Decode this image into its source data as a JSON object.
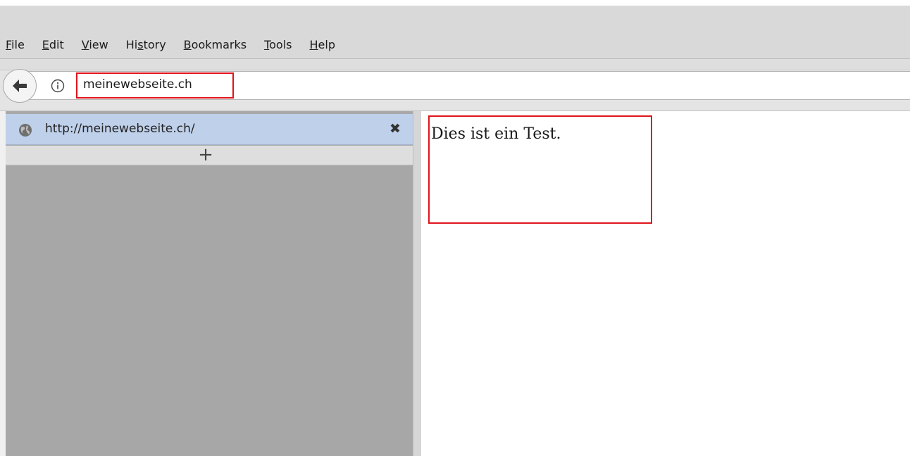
{
  "menubar": {
    "items": [
      {
        "label": "File",
        "underline": "F",
        "rest": "ile"
      },
      {
        "label": "Edit",
        "underline": "E",
        "rest": "dit"
      },
      {
        "label": "View",
        "underline": "V",
        "rest": "iew"
      },
      {
        "label": "History",
        "pre": "Hi",
        "underline": "s",
        "rest": "tory"
      },
      {
        "label": "Bookmarks",
        "underline": "B",
        "rest": "ookmarks"
      },
      {
        "label": "Tools",
        "underline": "T",
        "rest": "ools"
      },
      {
        "label": "Help",
        "underline": "H",
        "rest": "elp"
      }
    ]
  },
  "navbar": {
    "url": "meinewebseite.ch",
    "back_icon": "back-arrow-icon",
    "info_icon": "info-icon"
  },
  "sidebar": {
    "tabs": [
      {
        "title": "http://meinewebseite.ch/",
        "icon": "globe-icon",
        "close": "✖"
      }
    ],
    "new_tab": "+"
  },
  "page": {
    "text": "Dies ist ein Test."
  },
  "colors": {
    "highlight": "#e0141b",
    "selected_tab": "#bfd0ea",
    "sidebar_bg": "#a9a9a9"
  }
}
